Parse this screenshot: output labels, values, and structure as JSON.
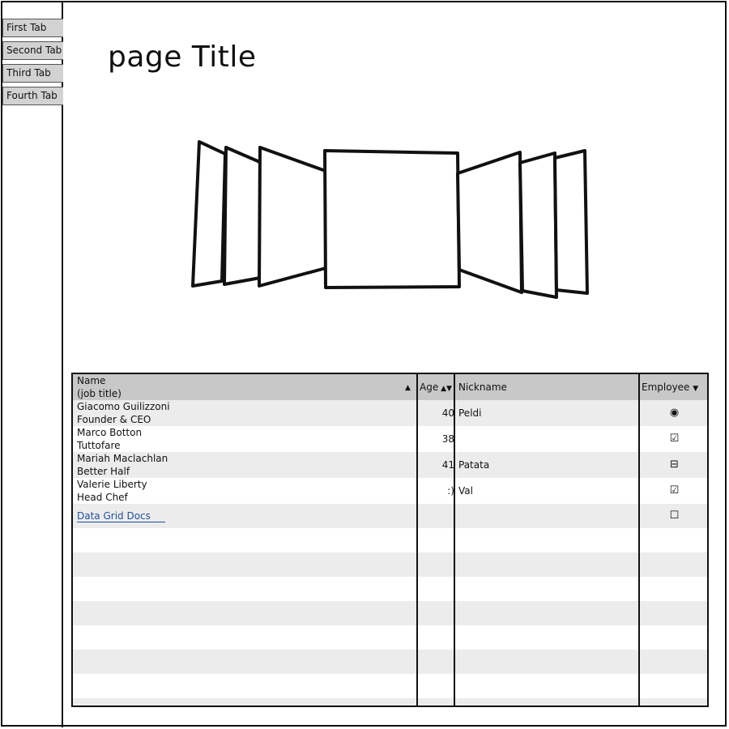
{
  "tabs": [
    {
      "label": "First Tab"
    },
    {
      "label": "Second Tab"
    },
    {
      "label": "Third Tab"
    },
    {
      "label": "Fourth Tab"
    }
  ],
  "page": {
    "title": "page Title"
  },
  "grid": {
    "headers": {
      "name_line1": "Name",
      "name_line2": "(job title)",
      "age": "Age",
      "nickname": "Nickname",
      "employee": "Employee"
    },
    "rows": [
      {
        "name": "Giacomo Guilizzoni",
        "title": "Founder & CEO",
        "age": "40",
        "nickname": "Peldi",
        "employee_control": "radio-selected"
      },
      {
        "name": "Marco Botton",
        "title": "Tuttofare",
        "age": "38",
        "nickname": "",
        "employee_control": "checkbox-checked"
      },
      {
        "name": "Mariah Maclachlan",
        "title": "Better Half",
        "age": "41",
        "nickname": "Patata",
        "employee_control": "checkbox-indeterminate"
      },
      {
        "name": "Valerie Liberty",
        "title": "Head Chef",
        "age": ":)",
        "nickname": "Val",
        "employee_control": "checkbox-checked"
      }
    ],
    "link_row": {
      "label": "Data Grid Docs",
      "employee_control": "checkbox-unchecked"
    }
  },
  "colors": {
    "header_bg": "#c8c8c8",
    "alt_row_bg": "#ececec",
    "tab_bg": "#d2d2d2",
    "link": "#1f4f9a"
  },
  "icons": {
    "sort_up": "triangle-up-icon",
    "sort_both": "sort-both-icon",
    "dropdown": "triangle-down-icon",
    "radio": "radio-selected-icon",
    "check": "checkbox-checked-icon",
    "indeterminate": "checkbox-indeterminate-icon",
    "unchecked": "checkbox-unchecked-icon"
  }
}
